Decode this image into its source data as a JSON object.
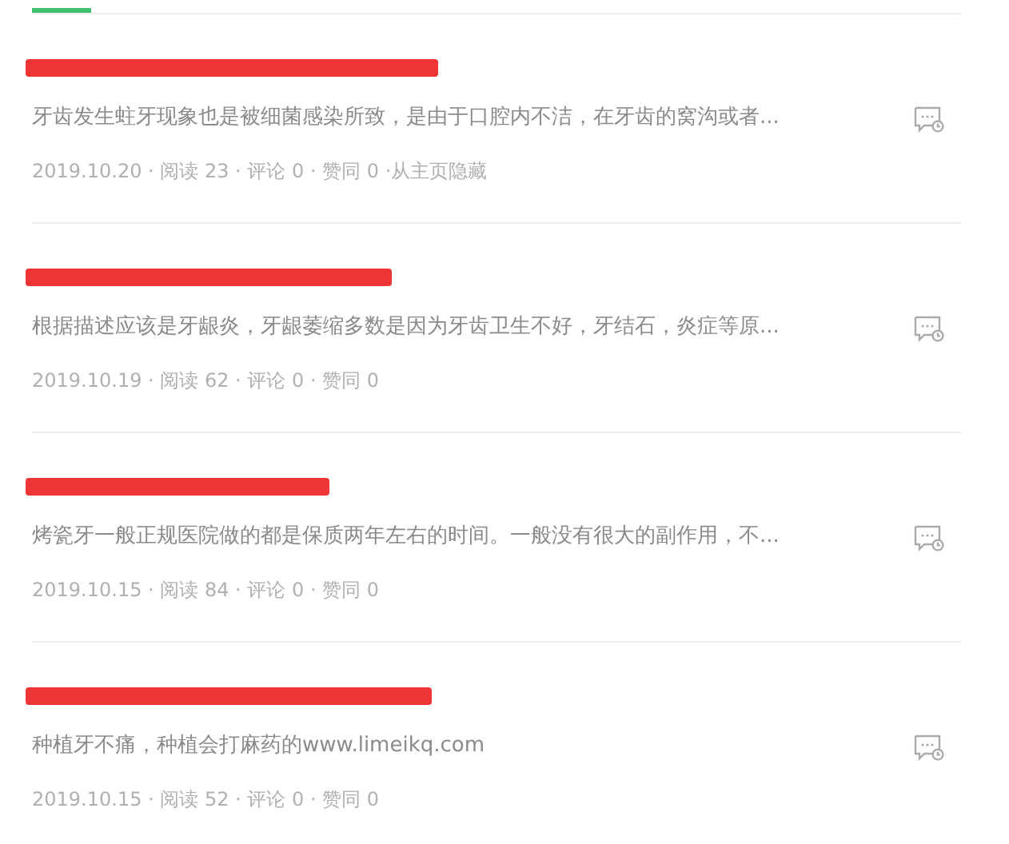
{
  "tabs": [
    {
      "selected": true
    }
  ],
  "articles": [
    {
      "excerpt": "牙齿发生蛀牙现象也是被细菌感染所致，是由于口腔内不洁，在牙齿的窝沟或者...",
      "meta": "2019.10.20 · 阅读 23 · 评论 0 · 赞同 0 · ",
      "action": "从主页隐藏"
    },
    {
      "excerpt": "根据描述应该是牙龈炎，牙龈萎缩多数是因为牙齿卫生不好，牙结石，炎症等原...",
      "meta": "2019.10.19 · 阅读 62 · 评论 0 · 赞同 0"
    },
    {
      "excerpt": "烤瓷牙一般正规医院做的都是保质两年左右的时间。一般没有很大的副作用，不...",
      "meta": "2019.10.15 · 阅读 84 · 评论 0 · 赞同 0"
    },
    {
      "excerpt": "种植牙不痛，种植会打麻药的www.limeikq.com",
      "meta": "2019.10.15 · 阅读 52 · 评论 0 · 赞同 0"
    }
  ]
}
